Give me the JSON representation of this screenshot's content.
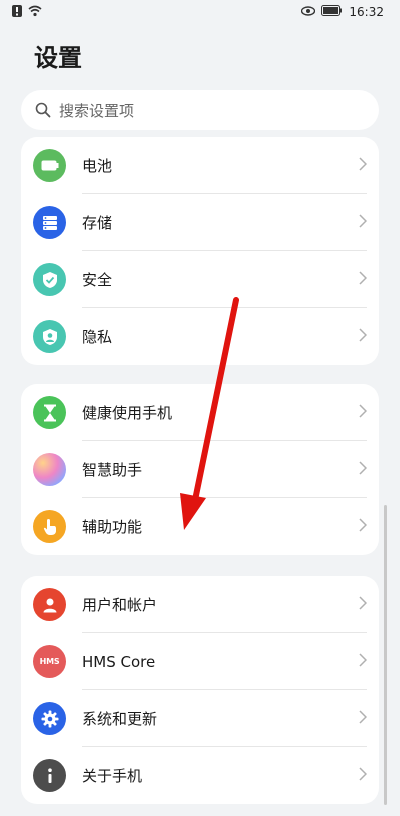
{
  "status": {
    "time": "16:32"
  },
  "page": {
    "title": "设置"
  },
  "search": {
    "placeholder": "搜索设置项"
  },
  "groups": [
    {
      "items": [
        {
          "label": "电池",
          "icon": "battery-icon",
          "color": "#5cbb5f"
        },
        {
          "label": "存储",
          "icon": "storage-icon",
          "color": "#2a63e6"
        },
        {
          "label": "安全",
          "icon": "shield-check-icon",
          "color": "#48c6b1"
        },
        {
          "label": "隐私",
          "icon": "privacy-icon",
          "color": "#48c6b1"
        }
      ]
    },
    {
      "items": [
        {
          "label": "健康使用手机",
          "icon": "hourglass-icon",
          "color": "#4ac359"
        },
        {
          "label": "智慧助手",
          "icon": "assistant-icon",
          "color": "#c58ee8"
        },
        {
          "label": "辅助功能",
          "icon": "hand-pointer-icon",
          "color": "#f5a623"
        }
      ]
    },
    {
      "items": [
        {
          "label": "用户和帐户",
          "icon": "user-icon",
          "color": "#e5452f"
        },
        {
          "label": "HMS Core",
          "icon": "hms-core-icon",
          "color": "#e45a5a",
          "icon_text": "HMS"
        },
        {
          "label": "系统和更新",
          "icon": "gear-icon",
          "color": "#2a63e6"
        },
        {
          "label": "关于手机",
          "icon": "info-icon",
          "color": "#4d4d4d"
        }
      ]
    }
  ],
  "colors": {
    "arrow": "#e0140f",
    "background": "#f1f3f5"
  }
}
